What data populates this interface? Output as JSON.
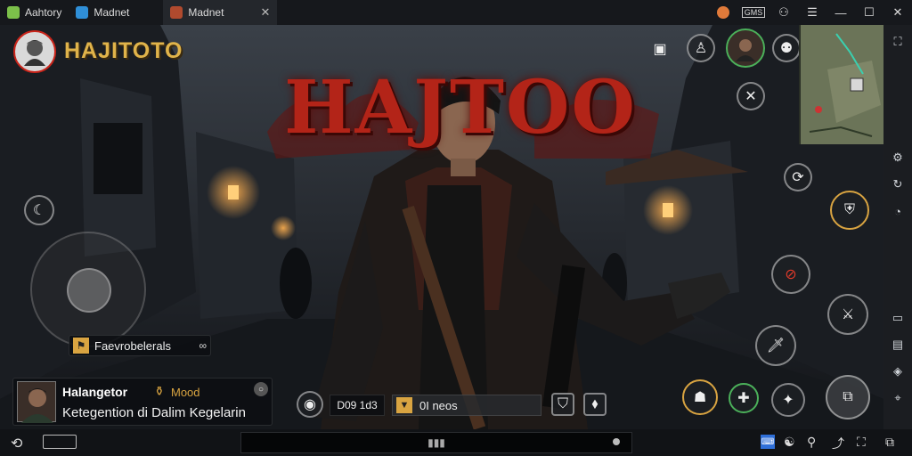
{
  "tabs": [
    {
      "label": "Aahtory",
      "color": "#7cc04a"
    },
    {
      "label": "Madnet",
      "color": "#2f8fd8"
    },
    {
      "label": "Madnet",
      "color": "#b04a2e"
    }
  ],
  "titlebar": {
    "status_badge": "GMS"
  },
  "game": {
    "player_name": "HAJITOTO",
    "title_art": "HAJTOO",
    "item_label": "Faevrobelerals",
    "profile": {
      "name": "Halangetor",
      "mood_label": "Mood",
      "message": "Ketegention di Dalim Kegelarin"
    },
    "hud": {
      "counter": "D09 1d3",
      "news_label": "0I neos"
    }
  },
  "colors": {
    "accent": "#d9a441",
    "title_red": "#b32418",
    "gold": "#e0b34a"
  }
}
